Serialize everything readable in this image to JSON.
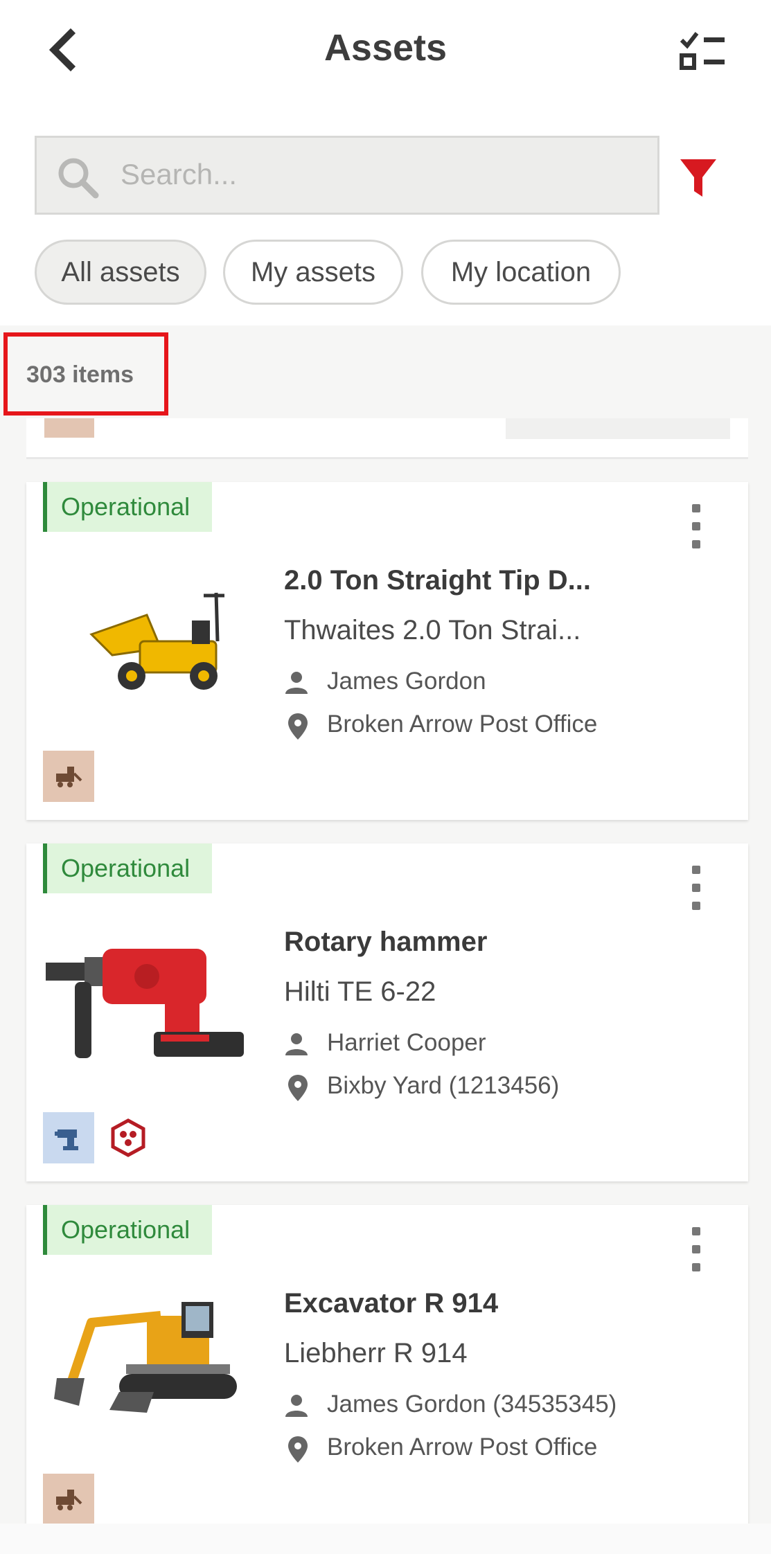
{
  "header": {
    "title": "Assets",
    "back_icon": "chevron-left-icon",
    "checklist_icon": "checklist-icon"
  },
  "search": {
    "placeholder": "Search...",
    "value": "",
    "icon": "search-icon",
    "filter_icon": "filter-icon",
    "filter_color": "#d71920"
  },
  "chips": [
    {
      "label": "All assets",
      "active": true
    },
    {
      "label": "My assets",
      "active": false
    },
    {
      "label": "My location",
      "active": false
    }
  ],
  "list": {
    "count_label": "303 items"
  },
  "assets": [
    {
      "status": "Operational",
      "name": "2.0 Ton Straight Tip D...",
      "model": "Thwaites 2.0 Ton Strai...",
      "person": "James Gordon",
      "location": "Broken Arrow Post Office",
      "image": "dumper-truck",
      "category_icon": "heavy-equipment-icon"
    },
    {
      "status": "Operational",
      "name": "Rotary hammer",
      "model": "Hilti TE 6-22",
      "person": "Harriet Cooper",
      "location": "Bixby Yard (1213456)",
      "image": "rotary-hammer",
      "category_icon": "power-tool-icon",
      "extra_icon": "hilti-hex-icon"
    },
    {
      "status": "Operational",
      "name": "Excavator R 914",
      "model": "Liebherr R 914",
      "person": "James Gordon (34535345)",
      "location": "Broken Arrow Post Office",
      "image": "excavator",
      "category_icon": "heavy-equipment-icon"
    }
  ],
  "colors": {
    "accent_red": "#d71920",
    "status_green": "#2f8a3c",
    "status_bg": "#dff5dc",
    "highlight": "#e6161b"
  }
}
